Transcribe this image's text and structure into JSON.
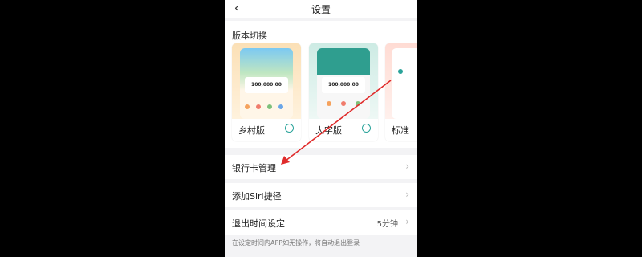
{
  "header": {
    "title": "设置",
    "back_icon": "chevron-left-icon"
  },
  "version_section": {
    "title": "版本切换",
    "options": [
      {
        "label": "乡村版",
        "balance": "100,000.00",
        "selected": false
      },
      {
        "label": "大字版",
        "balance": "100,000.00",
        "selected": false
      },
      {
        "label": "标准",
        "selected": false
      }
    ]
  },
  "settings": {
    "bank_card": {
      "label": "银行卡管理"
    },
    "siri": {
      "label": "添加Siri捷径"
    },
    "logout_time": {
      "label": "退出时间设定",
      "value": "5分钟"
    }
  },
  "hint_text": "在设定时间内APP如无操作，将自动退出登录",
  "colors": {
    "accent": "#2aa39a",
    "annotation_arrow": "#e02b2b",
    "rural_theme": "#f6c98b",
    "large_font_theme": "#2f9e8f"
  }
}
